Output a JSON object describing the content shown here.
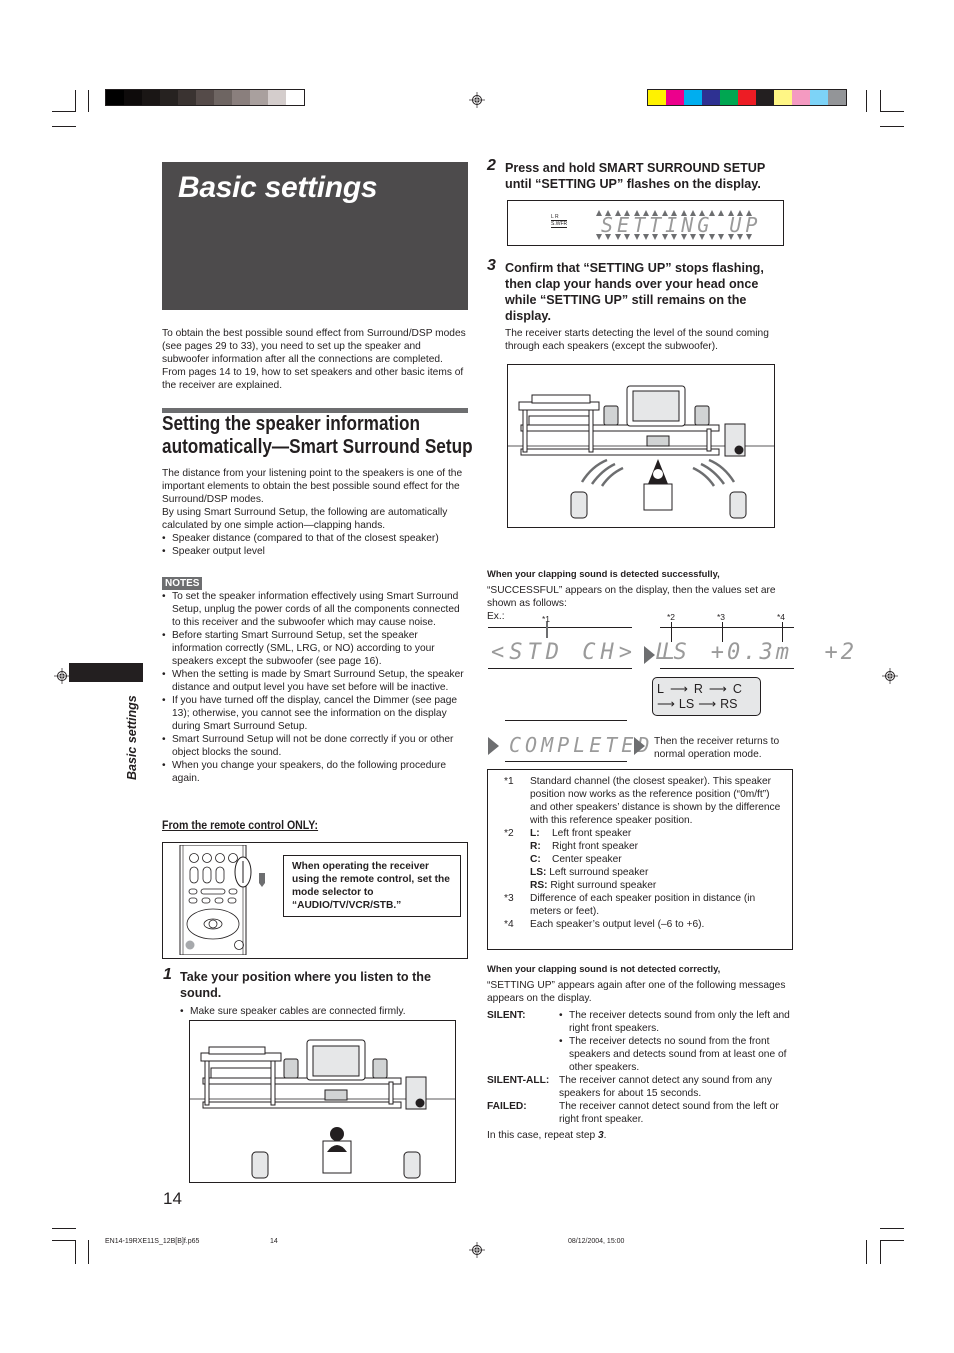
{
  "print_marks": {
    "grayscale_swatches": [
      "#000000",
      "#0e0b0b",
      "#1a1615",
      "#262220",
      "#3a3331",
      "#554b49",
      "#6e6562",
      "#8a7f7d",
      "#a9a09e",
      "#d4cdcc",
      "#ffffff"
    ],
    "color_swatches": [
      "#fff200",
      "#ec008c",
      "#00aeef",
      "#2e3192",
      "#00a651",
      "#ed1c24",
      "#231f20",
      "#fff685",
      "#f49ac1",
      "#7dd3f7",
      "#939598"
    ]
  },
  "title_box": {
    "title": "Basic settings",
    "bg_color": "#4d4b4c"
  },
  "side_tab": {
    "label": "Basic settings"
  },
  "intro_text": "To obtain the best possible sound effect from Surround/DSP modes (see pages 29 to 33), you need to set up the speaker and subwoofer information after all the connections are completed. From pages 14 to 19, how to set speakers and other basic items of the receiver are explained.",
  "section": {
    "heading_line1": "Setting the speaker information",
    "heading_line2": "automatically—Smart Surround Setup",
    "para1": "The distance from your listening point to the speakers is one of the important elements to obtain the best possible sound effect for the Surround/DSP modes.",
    "para2": "By using Smart Surround Setup, the following are automatically calculated by one simple action—clapping hands.",
    "bullets": [
      "Speaker distance (compared to that of the closest speaker)",
      "Speaker output level"
    ]
  },
  "notes": {
    "label": "NOTES",
    "items": [
      "To set the speaker information effectively using Smart Surround Setup, unplug the power cords of all the components connected to this receiver and the subwoofer which may cause noise.",
      "Before starting Smart Surround Setup, set the speaker information correctly (SML, LRG, or NO) according to your speakers except the subwoofer (see page 16).",
      "When the setting is made by Smart Surround Setup, the speaker distance and output level you have set before will be inactive.",
      "If you have turned off the display, cancel the Dimmer (see page 13); otherwise, you cannot see the information on the display during Smart Surround Setup.",
      "Smart Surround Setup will not be done correctly if you or other object blocks the sound.",
      "When you change your speakers, do the following procedure again."
    ]
  },
  "remote": {
    "heading": "From the remote control ONLY:",
    "instruction": "When operating the receiver using the remote control, set the mode selector to “AUDIO/TV/VCR/STB.”"
  },
  "steps": [
    {
      "num": "1",
      "text": "Take your position where you listen to the sound.",
      "bullets": [
        "Make sure speaker cables are connected firmly."
      ]
    },
    {
      "num": "2",
      "text": "Press and hold SMART SURROUND SETUP until “SETTING UP” flashes on the display.",
      "display": {
        "indicator_top": "L  R",
        "indicator_bottom": "S.WFR",
        "text": "SETTING UP"
      }
    },
    {
      "num": "3",
      "text": "Confirm that “SETTING UP” stops flashing, then clap your hands over your head once while “SETTING UP” still remains on the display.",
      "desc": "The receiver starts detecting the level of the sound coming through each speakers (except the subwoofer)."
    }
  ],
  "success": {
    "heading": "When your clapping sound is detected successfully,",
    "text": "“SUCCESSFUL” appears on the display, then the values set are shown as follows:",
    "ex_label": "Ex.:",
    "display1": "<STD CH> LS",
    "display2": "L  +0.3m  +2",
    "markers": [
      "*1",
      "*2",
      "*3",
      "*4"
    ],
    "sequence": {
      "line1": [
        "L",
        "R",
        "C"
      ],
      "line2": [
        "LS",
        "RS"
      ]
    },
    "completed_display": "COMPLETED",
    "completed_text": "Then the receiver returns to normal operation mode."
  },
  "footnotes": {
    "n1": {
      "key": "*1",
      "text": "Standard channel (the closest speaker). This speaker position now works as the reference position (“0m/ft”) and other speakers’ distance is shown by the difference with this reference speaker position."
    },
    "n2": {
      "key": "*2",
      "items": [
        {
          "k": "L:",
          "v": "Left front speaker"
        },
        {
          "k": "R:",
          "v": "Right front speaker"
        },
        {
          "k": "C:",
          "v": "Center speaker"
        },
        {
          "k": "LS:",
          "v": "Left surround speaker"
        },
        {
          "k": "RS:",
          "v": "Right surround speaker"
        }
      ]
    },
    "n3": {
      "key": "*3",
      "text": "Difference of each speaker position in distance (in meters or feet)."
    },
    "n4": {
      "key": "*4",
      "text": "Each speaker’s output level (–6 to +6)."
    }
  },
  "failure": {
    "heading": "When your clapping sound is not detected correctly,",
    "text": "“SETTING UP” appears again after one of the following messages appears on the display.",
    "silent": {
      "key": "SILENT:",
      "bullets": [
        "The receiver detects sound from only the left and right front speakers.",
        "The receiver detects no sound from the front speakers and detects sound from at least one of other speakers."
      ]
    },
    "silent_all": {
      "key": "SILENT-ALL:",
      "text": "The receiver cannot detect any sound from any speakers for about 15 seconds."
    },
    "failed": {
      "key": "FAILED:",
      "text": "The receiver cannot detect sound from the left or right front speaker."
    },
    "repeat_prefix": "In this case, repeat step ",
    "repeat_step": "3",
    "repeat_suffix": "."
  },
  "page_number": "14",
  "footer": {
    "file": "EN14-19RXE11S_12B[B]f.p65",
    "page": "14",
    "timestamp": "08/12/2004, 15:00"
  }
}
